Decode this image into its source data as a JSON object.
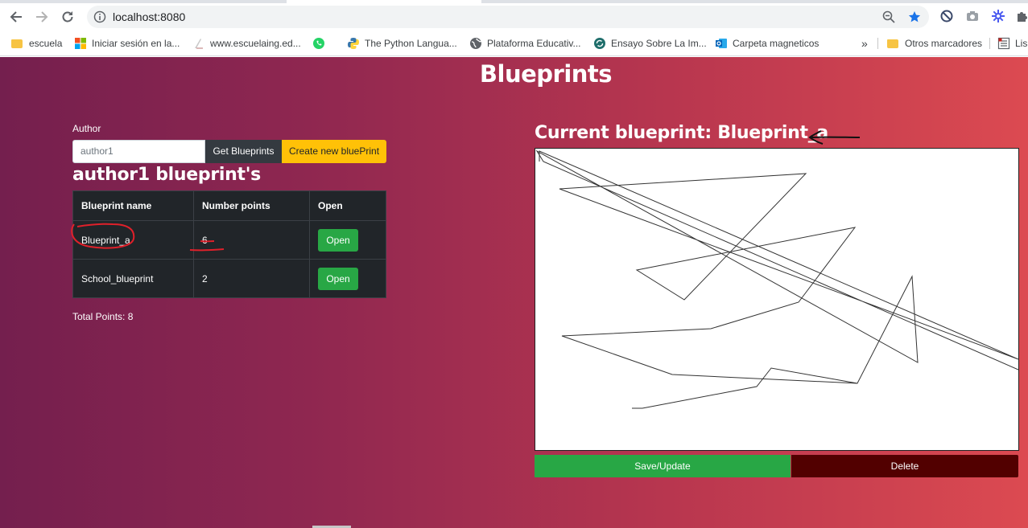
{
  "browser": {
    "url": "localhost:8080",
    "bookmarks": [
      {
        "label": "escuela",
        "icon": "folder-icon"
      },
      {
        "label": "Iniciar sesión en la...",
        "icon": "microsoft-icon"
      },
      {
        "label": "www.escuelaing.ed...",
        "icon": "school-icon"
      },
      {
        "label": "",
        "icon": "whatsapp-icon"
      },
      {
        "label": "The Python Langua...",
        "icon": "python-icon"
      },
      {
        "label": "Plataforma Educativ...",
        "icon": "globe-icon"
      },
      {
        "label": "Ensayo Sobre La Im...",
        "icon": "sync-icon"
      },
      {
        "label": "Carpeta magneticos",
        "icon": "outlook-icon"
      }
    ],
    "overflow_label": "»",
    "other_bookmarks": "Otros marcadores",
    "reading_list": "Lis"
  },
  "page": {
    "title": "Blueprints",
    "author_label": "Author",
    "author_input_value": "author1",
    "get_button": "Get Blueprints",
    "create_button": "Create new bluePrint",
    "blueprints_title": "author1 blueprint's",
    "table": {
      "headers": [
        "Blueprint name",
        "Number points",
        "Open"
      ],
      "rows": [
        {
          "name": "Blueprint_a",
          "points": "6",
          "action": "Open"
        },
        {
          "name": "School_blueprint",
          "points": "2",
          "action": "Open"
        }
      ]
    },
    "total_points": "Total Points: 8",
    "current_title": "Current blueprint: Blueprint_a",
    "save_button": "Save/Update",
    "delete_button": "Delete"
  },
  "colors": {
    "gradient_start": "#741f4e",
    "gradient_end": "#dc4a51",
    "open_green": "#28a745",
    "create_yellow": "#ffc107",
    "delete_dark": "#520000",
    "annotation_red": "#e0202a"
  }
}
